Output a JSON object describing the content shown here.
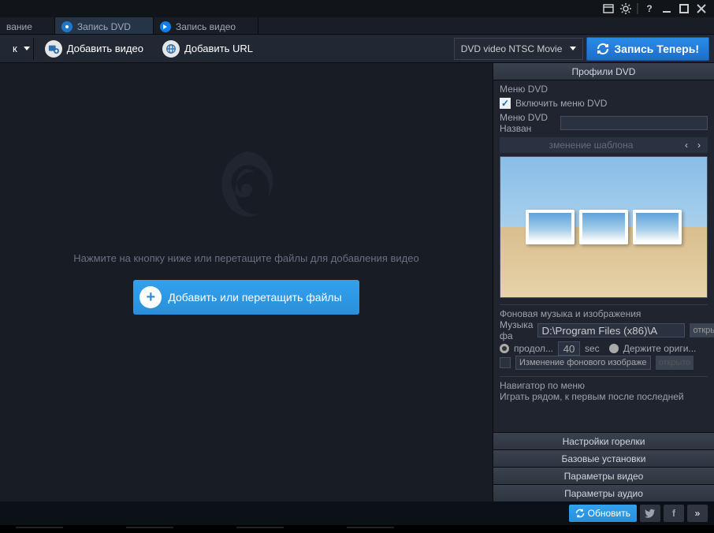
{
  "tabs": {
    "t0": "вание",
    "t1": "Запись DVD",
    "t2": "Запись видео"
  },
  "toolbar": {
    "truncated_btn": "к",
    "add_video": "Добавить видео",
    "add_url": "Добавить URL",
    "format": "DVD video NTSC Movie",
    "burn_now": "Запись Теперь!"
  },
  "canvas": {
    "hint": "Нажмите на кнопку ниже или перетащите файлы для добавления видео",
    "add_button": "Добавить или перетащить файлы"
  },
  "side": {
    "profiles": "Профили DVD",
    "menu_group": "Меню DVD",
    "enable_menu": "Включить меню DVD",
    "menu_name_label": "Меню DVD Назван",
    "template_change": "зменение шаблона",
    "bg_group": "Фоновая музыка и изображения",
    "music_label": "Музыка фа",
    "music_path": "D:\\Program Files (x86)\\A",
    "open": "открыто",
    "duration": "продол...",
    "duration_val": "40",
    "sec": "sec",
    "keep_orig": "Держите ориги...",
    "change_bg": "Изменение фонового изображе",
    "nav_group": "Навигатор по меню",
    "nav_text": "Играть рядом, к первым после последней",
    "sections": {
      "burner": "Настройки горелки",
      "basic": "Базовые установки",
      "video": "Параметры видео",
      "audio": "Параметры аудио"
    }
  },
  "footer": {
    "refresh": "Обновить"
  }
}
